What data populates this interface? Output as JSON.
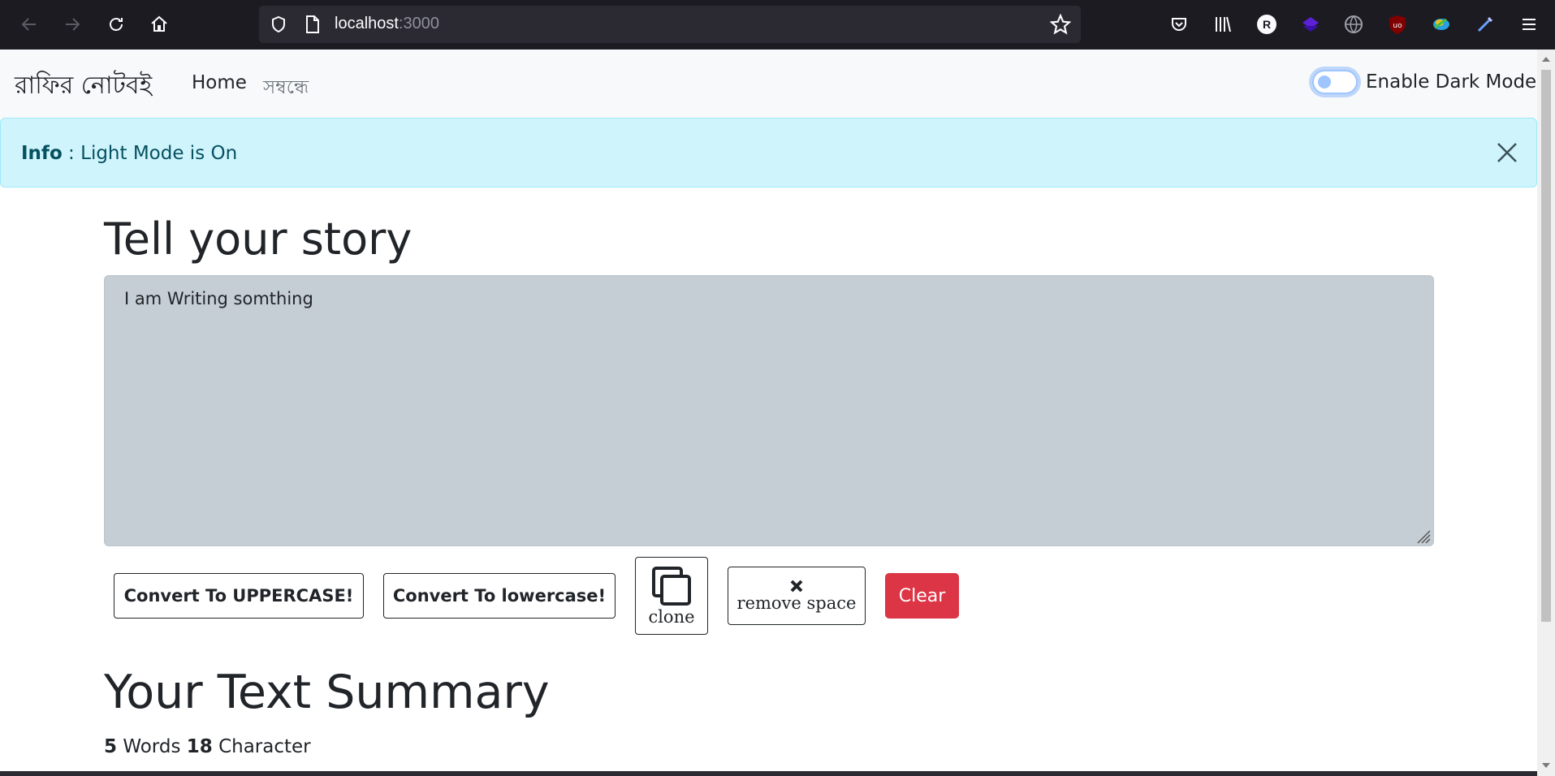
{
  "browser": {
    "url_host": "localhost",
    "url_port": ":3000"
  },
  "navbar": {
    "brand": "রাফির নোটবই",
    "links": [
      {
        "label": "Home",
        "active": true
      },
      {
        "label": "সম্বন্ধে",
        "active": false
      }
    ],
    "dark_mode_label": "Enable Dark Mode",
    "dark_mode_on": false
  },
  "alert": {
    "type": "Info",
    "separator": " : ",
    "message": "Light Mode is On"
  },
  "main": {
    "heading": "Tell your story",
    "textarea_value": "I am Writing somthing",
    "buttons": {
      "upper": "Convert To UPPERCASE!",
      "lower": "Convert To lowercase!",
      "clone": "clone",
      "remove_space": "remove space",
      "clear": "Clear"
    },
    "summary_heading": "Your Text Summary",
    "summary": {
      "words": "5",
      "words_label": " Words ",
      "chars": "18",
      "chars_label": " Character"
    }
  },
  "colors": {
    "navbar_bg": "#f8f9fa",
    "alert_bg": "#cff4fc",
    "alert_text": "#055160",
    "textarea_bg": "#c5cdd5",
    "danger": "#dc3545"
  }
}
